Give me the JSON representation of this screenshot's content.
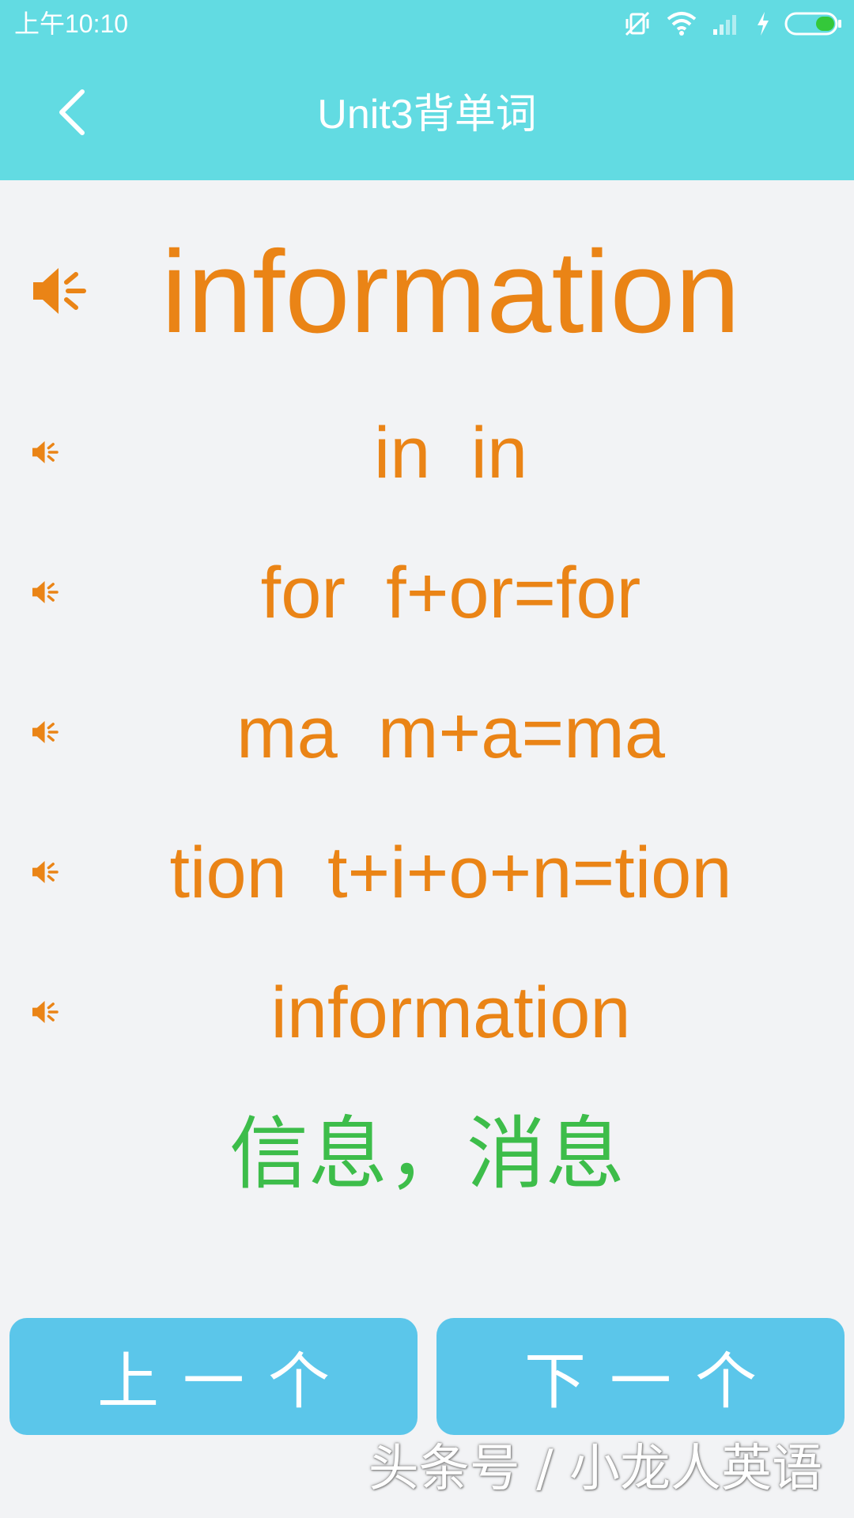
{
  "status_bar": {
    "time": "上午10:10",
    "icons": [
      "mute-vibrate-icon",
      "wifi-icon",
      "signal-icon",
      "charging-icon",
      "battery-icon"
    ]
  },
  "header": {
    "title": "Unit3背单词",
    "back_icon": "chevron-left-icon"
  },
  "word": {
    "main": "information",
    "syllables": [
      "in  in",
      "for  f+or=for",
      "ma  m+a=ma",
      "tion  t+i+o+n=tion",
      "information"
    ],
    "meaning": "信息，消息"
  },
  "buttons": {
    "prev": "上一个",
    "next": "下一个"
  },
  "watermark": "头条号 / 小龙人英语",
  "colors": {
    "header_bg": "#62dbe2",
    "word_orange": "#ea8416",
    "meaning_green": "#3dbd4a",
    "button_blue": "#5bc6ea",
    "page_bg": "#f2f3f5"
  }
}
